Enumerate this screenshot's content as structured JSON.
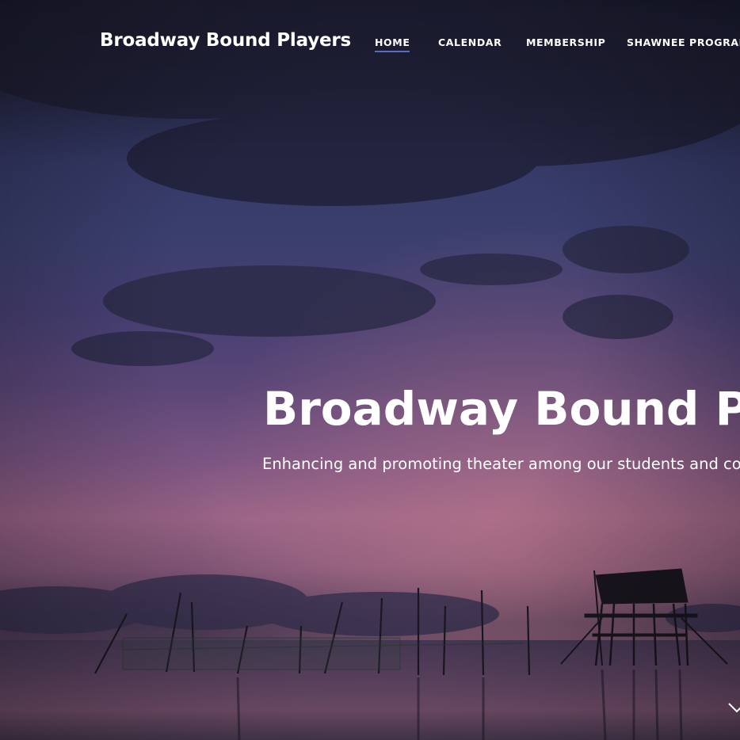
{
  "header": {
    "brand": "Broadway Bound Players",
    "nav": [
      {
        "label": "HOME",
        "active": true
      },
      {
        "label": "CALENDAR",
        "active": false
      },
      {
        "label": "MEMBERSHIP",
        "active": false
      },
      {
        "label": "SHAWNEE PROGRAM",
        "active": false
      }
    ]
  },
  "hero": {
    "title": "Broadway Bound Players",
    "subtitle": "Enhancing and promoting theater among our students and community",
    "scroll_icon": "chevron-down-icon"
  },
  "colors": {
    "nav_active_underline": "#5c6bc0",
    "text": "#ffffff"
  }
}
